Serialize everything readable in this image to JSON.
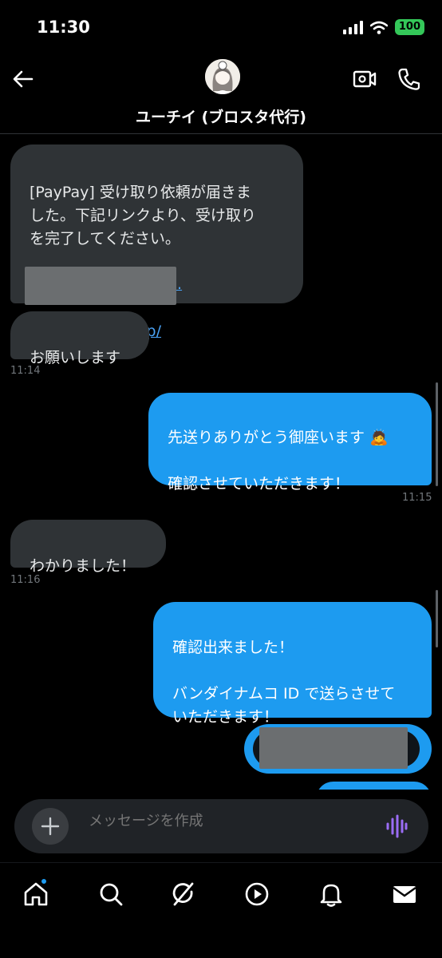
{
  "status_bar": {
    "time": "11:30",
    "battery": "100",
    "icons": [
      "cellular-signal-icon",
      "wifi-icon",
      "battery-icon"
    ]
  },
  "header": {
    "peer_name": "ユーチイ (ブロスタ代行)",
    "icons": [
      "back-arrow-icon",
      "video-call-icon",
      "phone-call-icon"
    ]
  },
  "messages": [
    {
      "direction": "incoming",
      "lines": "[PayPay] 受け取り依頼が届きま\nした。下記リンクより、受け取り\nを完了してください。",
      "link": "pay.paypay.ne.jp/",
      "link_suffix": "..",
      "redacted": true
    },
    {
      "direction": "incoming",
      "text": "お願いします",
      "time": "11:14"
    },
    {
      "direction": "outgoing",
      "text": "先送りありがとう御座います 🙇\n\n確認させていただきます！",
      "time": "11:15"
    },
    {
      "direction": "incoming",
      "text": "わかりました！",
      "time": "11:16"
    },
    {
      "direction": "outgoing",
      "text": "確認出来ました！\n\nバンダイナムコ ID で送らさせて\nいただきます！"
    },
    {
      "direction": "outgoing",
      "redacted": true
    }
  ],
  "composer": {
    "placeholder": "メッセージを作成",
    "icons": [
      "plus-icon",
      "voice-message-icon"
    ]
  },
  "tab_bar": {
    "items": [
      "home",
      "search",
      "grok",
      "video",
      "notifications",
      "messages"
    ],
    "home_has_badge": true
  },
  "colors": {
    "background": "#000000",
    "incoming_bubble": "#2f3336",
    "outgoing_bubble": "#1d9bf0",
    "link": "#4aa3f7",
    "battery": "#34c759"
  }
}
